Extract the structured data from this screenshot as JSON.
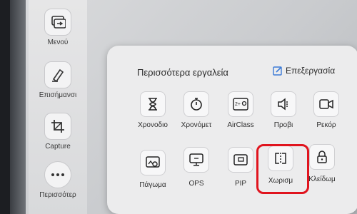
{
  "sidebar": {
    "items": [
      {
        "label": "Μενού",
        "icon": "menu-icon"
      },
      {
        "label": "Επισήμανσι",
        "icon": "highlighter-icon"
      },
      {
        "label": "Capture",
        "icon": "crop-icon"
      },
      {
        "label": "Περισσότερ",
        "icon": "more-icon"
      }
    ]
  },
  "panel": {
    "title": "Περισσότερα εργαλεία",
    "edit_label": "Επεξεργασία",
    "tools_row1": [
      {
        "label": "Χρονοδιο",
        "icon": "hourglass-icon"
      },
      {
        "label": "Χρονόμετ",
        "icon": "stopwatch-icon"
      },
      {
        "label": "AirClass",
        "icon": "airclass-icon"
      },
      {
        "label": "Προβι",
        "icon": "speaker-icon"
      },
      {
        "label": "Ρεκόρ",
        "icon": "video-camera-icon"
      }
    ],
    "tools_row2": [
      {
        "label": "Πάγωμα",
        "icon": "freeze-icon"
      },
      {
        "label": "OPS",
        "icon": "monitor-icon"
      },
      {
        "label": "PIP",
        "icon": "pip-icon"
      },
      {
        "label": "Χωρισμ",
        "icon": "split-screen-icon"
      },
      {
        "label": "Κλείδωμ",
        "icon": "lock-icon"
      }
    ]
  },
  "colors": {
    "highlight": "#e0141e",
    "edit_icon": "#3b7ad6"
  }
}
